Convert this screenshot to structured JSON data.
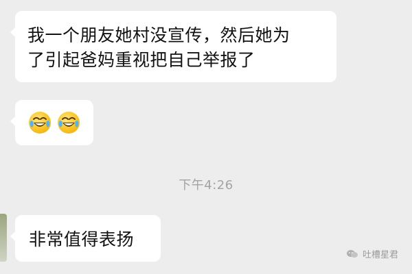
{
  "messages": [
    {
      "line1": "我一个朋友她村没宣传，然后她为",
      "line2": "了引起爸妈重视把自己举报了"
    },
    {
      "emoji_names": [
        "laugh-cry-emoji-icon",
        "laugh-cry-emoji-icon"
      ]
    }
  ],
  "timestamp": "下午4:26",
  "reply": {
    "text": "非常值得表扬"
  },
  "watermark": {
    "text": "吐槽星君",
    "icon": "wechat-logo-icon"
  },
  "colors": {
    "background": "#ededed",
    "bubble": "#ffffff",
    "text": "#111111",
    "timestamp": "#a3a3a3"
  }
}
